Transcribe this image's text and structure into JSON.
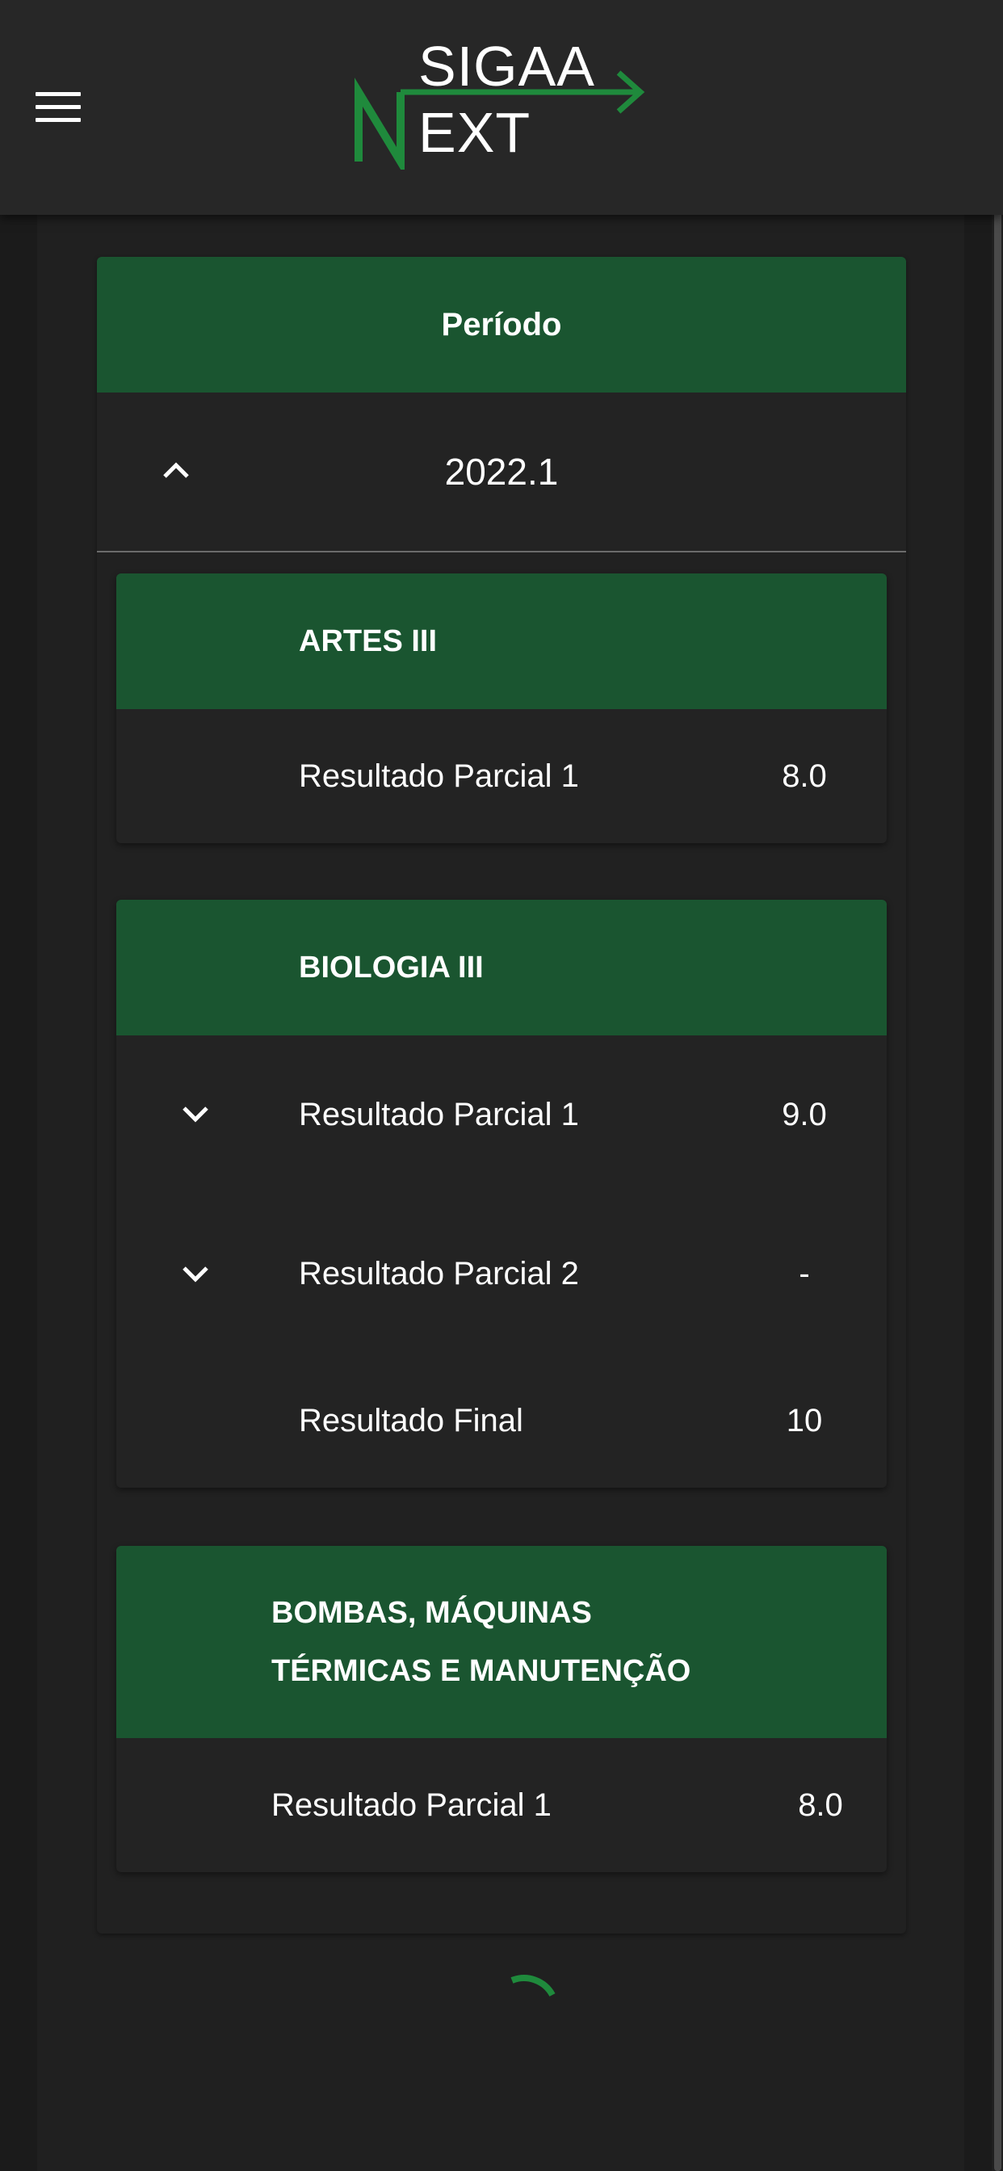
{
  "header": {
    "logo_top": "SIGAA",
    "logo_bottom": "EXT",
    "logo_accent_color": "#1f8a3c"
  },
  "periodo": {
    "title": "Período",
    "value": "2022.1",
    "expanded": true
  },
  "subjects": [
    {
      "name": "ARTES III",
      "grades": [
        {
          "label": "Resultado Parcial 1",
          "value": "8.0",
          "expandable": false
        }
      ]
    },
    {
      "name": "BIOLOGIA III",
      "grades": [
        {
          "label": "Resultado Parcial 1",
          "value": "9.0",
          "expandable": true
        },
        {
          "label": "Resultado Parcial 2",
          "value": "-",
          "expandable": true
        },
        {
          "label": "Resultado Final",
          "value": "10",
          "expandable": false
        }
      ]
    },
    {
      "name_line1": "BOMBAS, MÁQUINAS",
      "name_line2": "TÉRMICAS E MANUTENÇÃO",
      "grades": [
        {
          "label": "Resultado Parcial 1",
          "value": "8.0",
          "expandable": false
        }
      ]
    }
  ],
  "theme": {
    "primary": "#1a5530",
    "surface": "#232323",
    "background": "#1b1b1b"
  }
}
